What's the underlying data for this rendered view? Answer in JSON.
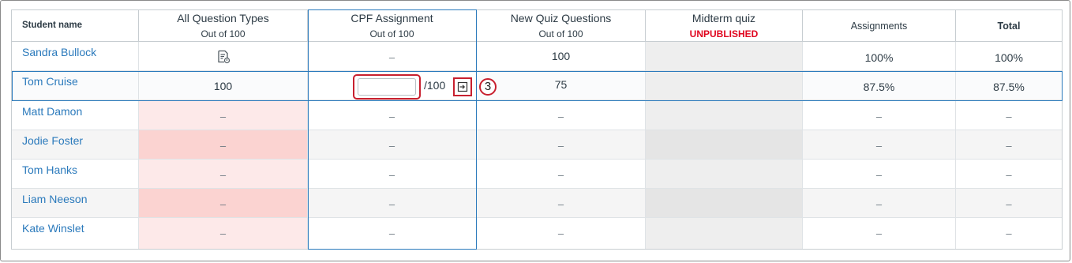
{
  "headers": {
    "student_name": "Student name",
    "all_question_types": {
      "title": "All Question Types",
      "sub": "Out of 100"
    },
    "cpf_assignment": {
      "title": "CPF Assignment",
      "sub": "Out of 100"
    },
    "new_quiz_questions": {
      "title": "New Quiz Questions",
      "sub": "Out of 100"
    },
    "midterm_quiz": {
      "title": "Midterm quiz",
      "sub": "UNPUBLISHED"
    },
    "assignments": "Assignments",
    "total": "Total"
  },
  "rows": [
    {
      "name": "Sandra Bullock",
      "aqt": "",
      "aqt_icon": "submission-document-icon",
      "cpf": "–",
      "nqq": "100",
      "midterm": "",
      "assignments": "100%",
      "total": "100%"
    },
    {
      "name": "Tom Cruise",
      "aqt": "100",
      "cpf": "",
      "nqq": "75",
      "midterm": "",
      "assignments": "87.5%",
      "total": "87.5%"
    },
    {
      "name": "Matt Damon",
      "aqt": "–",
      "cpf": "–",
      "nqq": "–",
      "midterm": "",
      "assignments": "–",
      "total": "–"
    },
    {
      "name": "Jodie Foster",
      "aqt": "–",
      "cpf": "–",
      "nqq": "–",
      "midterm": "",
      "assignments": "–",
      "total": "–"
    },
    {
      "name": "Tom Hanks",
      "aqt": "–",
      "cpf": "–",
      "nqq": "–",
      "midterm": "",
      "assignments": "–",
      "total": "–"
    },
    {
      "name": "Liam Neeson",
      "aqt": "–",
      "cpf": "–",
      "nqq": "–",
      "midterm": "",
      "assignments": "–",
      "total": "–"
    },
    {
      "name": "Kate Winslet",
      "aqt": "–",
      "cpf": "–",
      "nqq": "–",
      "midterm": "",
      "assignments": "–",
      "total": "–"
    }
  ],
  "editing": {
    "out_of": "/100",
    "callout_number": "3",
    "tray_icon": "open-grade-detail-tray-icon"
  },
  "colors": {
    "link": "#2b7abc",
    "unpublished": "#e0061f",
    "missing_bg": "#fde9e9",
    "highlight": "#c8202f",
    "selection": "#2b7abc"
  }
}
